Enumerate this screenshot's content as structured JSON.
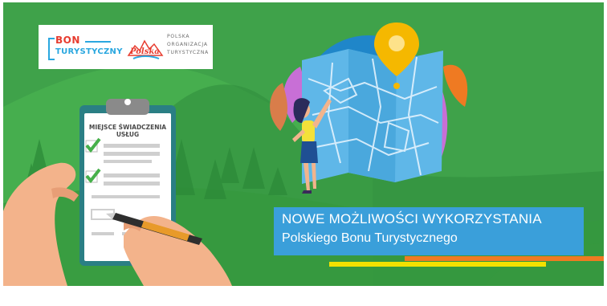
{
  "logo": {
    "bon_word": "BON",
    "bon_subword": "TURYSTYCZNY",
    "pot_mark": "Polska",
    "pot_lines": [
      "POLSKA",
      "ORGANIZACJA",
      "TURYSTYCZNA"
    ]
  },
  "clipboard": {
    "title_line1": "MIEJSCE ŚWIADCZENIA",
    "title_line2": "USŁUG"
  },
  "caption": {
    "line1": "NOWE MOŻLIWOŚCI WYKORZYSTANIA",
    "line2": "Polskiego Bonu Turystycznego"
  },
  "colors": {
    "background_green": "#3fa24a",
    "caption_blue": "#3a9fda",
    "stripe_orange": "#ef7a22",
    "stripe_yellow": "#f2e100",
    "map_blue": "#5fb7e8",
    "pin_yellow": "#f5b800"
  },
  "icons": [
    "map-pin-icon",
    "checkmark-icon",
    "pen-icon"
  ]
}
